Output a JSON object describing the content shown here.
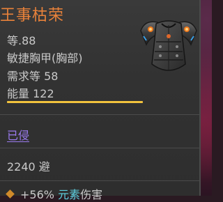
{
  "item": {
    "name": "王事枯荣",
    "quality_line": "等.88",
    "type_line": "敏捷胸甲(胸部)",
    "requirement_line": "需求等 58",
    "power_line": "能量 122",
    "power_fill_fraction": 0.82,
    "socket_text": "已侵",
    "armor_text": "2240 避",
    "affix": {
      "prefix": "+56%",
      "element_word": "元素",
      "suffix": "伤害"
    },
    "icon": "chest-armor-icon"
  },
  "colors": {
    "title": "#e9823a",
    "stat_text": "#c9c9c9",
    "power_bar": "#f2c33d",
    "socket_link": "#9b7bf0",
    "element_highlight": "#5ed0e0",
    "affix_bullet": "#d08a2a",
    "panel_bg": "#353535"
  }
}
